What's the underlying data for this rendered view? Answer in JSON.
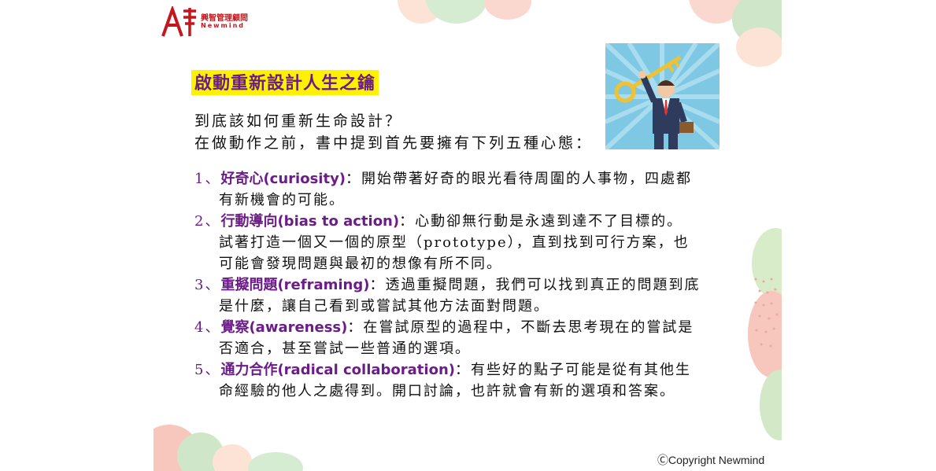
{
  "logo": {
    "cn": "興智管理顧問",
    "en": "Newmind"
  },
  "title": "啟動重新設計人生之鑰",
  "intro": [
    "到底該如何重新生命設計？",
    "在做動作之前，書中提到首先要擁有下列五種心態："
  ],
  "items": [
    {
      "num": "1、",
      "term": "好奇心(curiosity)",
      "sep": "：",
      "text": "開始帶著好奇的眼光看待周圍的人事物，四處都",
      "cont": [
        "有新機會的可能。"
      ]
    },
    {
      "num": "2、",
      "term": "行動導向(bias to action)",
      "sep": "：",
      "text": "心動卻無行動是永遠到達不了目標的。",
      "cont": [
        "試著打造一個又一個的原型（prototype），直到找到可行方案，也",
        "可能會發現問題與最初的想像有所不同。"
      ]
    },
    {
      "num": "3、",
      "term": "重擬問題(reframing)",
      "sep": "：",
      "text": "透過重擬問題，我們可以找到真正的問題到底",
      "cont": [
        "是什麼，讓自己看到或嘗試其他方法面對問題。"
      ]
    },
    {
      "num": "4、",
      "term": "覺察(awareness)",
      "sep": "：",
      "text": "在嘗試原型的過程中，不斷去思考現在的嘗試是",
      "cont": [
        "否適合，甚至嘗試一些普通的選項。"
      ]
    },
    {
      "num": "5、",
      "term": "通力合作(radical collaboration)",
      "sep": "：",
      "text": "有些好的點子可能是從有其他生",
      "cont": [
        "命經驗的他人之處得到。開口討論，也許就會有新的選項和答案。"
      ]
    }
  ],
  "copyright": "ⒸCopyright Newmind",
  "colors": {
    "accent": "#6b1c87",
    "highlight": "#fff200",
    "brand": "#c4161c"
  },
  "icons": [
    "logo-icon",
    "businessman-key-illustration"
  ]
}
